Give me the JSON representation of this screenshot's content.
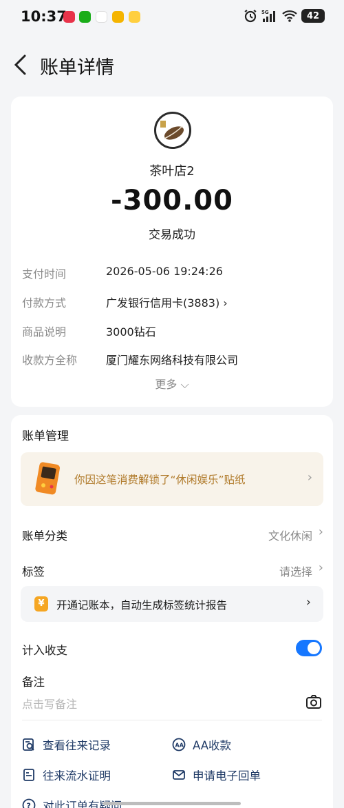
{
  "status_bar": {
    "time": "10:37",
    "battery": "42",
    "network": "5G",
    "notif_colors": [
      "#e8334a",
      "#1aad19",
      "#ff7a00",
      "#f5b400",
      "#ffcf3f"
    ]
  },
  "nav": {
    "title": "账单详情"
  },
  "summary": {
    "merchant": "茶叶店2",
    "amount": "-300.00",
    "status": "交易成功"
  },
  "details": [
    {
      "label": "支付时间",
      "value": "2026-05-06 19:24:26"
    },
    {
      "label": "付款方式",
      "value": "广发银行信用卡(3883) ›"
    },
    {
      "label": "商品说明",
      "value": "3000钻石"
    },
    {
      "label": "收款方全称",
      "value": "厦门耀东网络科技有限公司"
    }
  ],
  "more_label": "更多 ⌵",
  "management": {
    "title": "账单管理",
    "banner_text": "你因这笔消费解锁了“休闲娱乐”贴纸",
    "category_label": "账单分类",
    "category_value": "文化休闲",
    "tag_label": "标签",
    "tag_value": "请选择",
    "tip_icon": "¥",
    "tip_text": "开通记账本，自动生成标签统计报告",
    "include_label": "计入收支",
    "include_on": true,
    "note_label": "备注",
    "note_placeholder": "点击写备注"
  },
  "links": [
    {
      "label": "查看往来记录",
      "icon": "search-record-icon"
    },
    {
      "label": "AA收款",
      "icon": "aa-icon"
    },
    {
      "label": "往来流水证明",
      "icon": "document-icon"
    },
    {
      "label": "申请电子回单",
      "icon": "mail-icon"
    },
    {
      "label": "对此订单有疑问",
      "icon": "question-icon"
    }
  ],
  "colors": {
    "accent": "#1677ff",
    "banner_text": "#b07a2a",
    "link": "#1f3a66"
  }
}
